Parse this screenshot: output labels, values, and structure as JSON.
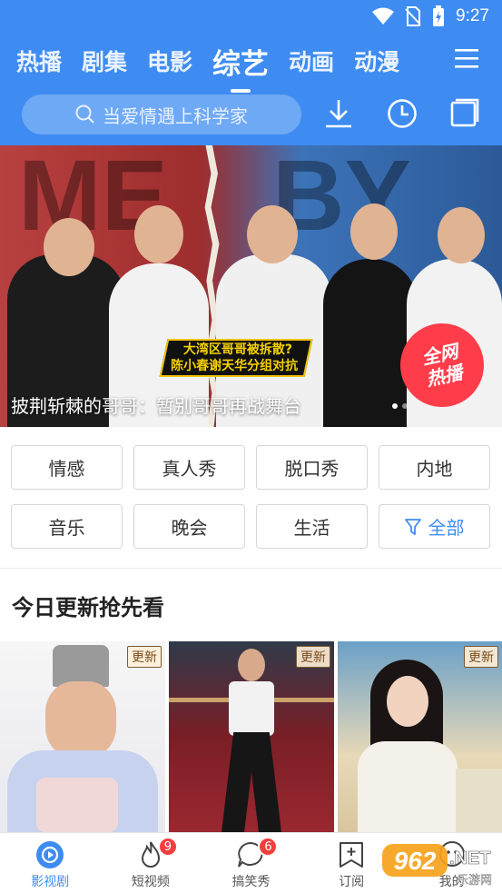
{
  "status": {
    "time": "9:27"
  },
  "tabs": [
    {
      "label": "热播"
    },
    {
      "label": "剧集"
    },
    {
      "label": "电影"
    },
    {
      "label": "综艺",
      "active": true
    },
    {
      "label": "动画"
    },
    {
      "label": "动漫"
    }
  ],
  "search": {
    "placeholder": "当爱情遇上科学家"
  },
  "banner": {
    "caption": "披荆斩棘的哥哥：暂别哥哥再战舞台",
    "badge_line1": "大湾区哥哥被拆散?",
    "badge_line2": "陈小春谢天华分组对抗",
    "hot_line1": "全网",
    "hot_line2": "热播",
    "bg_left": "ME",
    "bg_right": "BY"
  },
  "categories": [
    "情感",
    "真人秀",
    "脱口秀",
    "内地",
    "音乐",
    "晚会",
    "生活",
    "全部"
  ],
  "section": {
    "title": "今日更新抢先看"
  },
  "thumbnails": [
    {
      "tag": "更新"
    },
    {
      "tag": "更新"
    },
    {
      "tag": "更新"
    }
  ],
  "bottom_nav": [
    {
      "label": "影视剧",
      "icon": "play-icon",
      "active": true
    },
    {
      "label": "短视频",
      "icon": "flame-icon",
      "badge": "9"
    },
    {
      "label": "搞笑秀",
      "icon": "bubble-icon",
      "badge": "6"
    },
    {
      "label": "订阅",
      "icon": "subscribe-icon"
    },
    {
      "label": "我的",
      "icon": "profile-icon"
    }
  ],
  "watermark": {
    "num": "962",
    "suffix": ".NET",
    "sub": "乐游网"
  },
  "colors": {
    "primary": "#3e8cf2",
    "badge": "#f33e3e"
  }
}
